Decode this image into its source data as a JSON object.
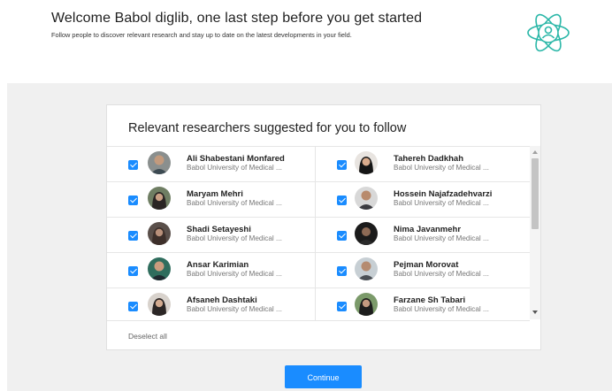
{
  "header": {
    "title": "Welcome Babol diglib, one last step before you get started",
    "subtitle": "Follow people to discover relevant research and stay up to date on the latest developments in your field.",
    "logo_icon": "atom-person-icon",
    "accent": "#2bb7a8"
  },
  "card": {
    "title": "Relevant researchers suggested for you to follow",
    "researchers": [
      {
        "name": "Ali Shabestani Monfared",
        "affiliation": "Babol University of Medical ...",
        "checked": true
      },
      {
        "name": "Tahereh Dadkhah",
        "affiliation": "Babol University of Medical ...",
        "checked": true
      },
      {
        "name": "Maryam Mehri",
        "affiliation": "Babol University of Medical ...",
        "checked": true
      },
      {
        "name": "Hossein Najafzadehvarzi",
        "affiliation": "Babol University of Medical ...",
        "checked": true
      },
      {
        "name": "Shadi Setayeshi",
        "affiliation": "Babol University of Medical ...",
        "checked": true
      },
      {
        "name": "Nima Javanmehr",
        "affiliation": "Babol University of Medical ...",
        "checked": true
      },
      {
        "name": "Ansar Karimian",
        "affiliation": "Babol University of Medical ...",
        "checked": true
      },
      {
        "name": "Pejman Morovat",
        "affiliation": "Babol University of Medical ...",
        "checked": true
      },
      {
        "name": "Afsaneh Dashtaki",
        "affiliation": "Babol University of Medical ...",
        "checked": true
      },
      {
        "name": "Farzane Sh Tabari",
        "affiliation": "Babol University of Medical ...",
        "checked": true
      }
    ],
    "deselect_label": "Deselect all"
  },
  "continue_label": "Continue",
  "colors": {
    "primary": "#1a8cff",
    "background": "#f0f0f0"
  }
}
